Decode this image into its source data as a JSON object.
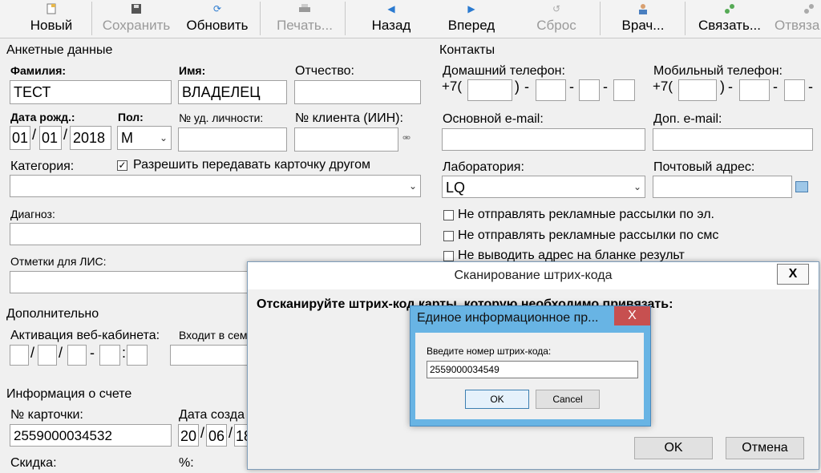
{
  "toolbar": {
    "new": "Новый",
    "save": "Сохранить",
    "refresh": "Обновить",
    "print": "Печать...",
    "back": "Назад",
    "forward": "Вперед",
    "reset": "Сброс",
    "doctor": "Врач...",
    "link": "Связать...",
    "unlink": "Отвяза"
  },
  "profile": {
    "group_title": "Анкетные данные",
    "last_name_label": "Фамилия:",
    "last_name_value": "ТЕСТ",
    "first_name_label": "Имя:",
    "first_name_value": "ВЛАДЕЛЕЦ",
    "patronymic_label": "Отчество:",
    "patronymic_value": "",
    "birth_label": "Дата рожд.:",
    "birth_day": "01",
    "birth_month": "01",
    "birth_year": "2018",
    "date_sep": "/",
    "sex_label": "Пол:",
    "sex_value": "М",
    "id_label": "№ уд. личности:",
    "iin_label": "№ клиента (ИИН):",
    "category_label": "Категория:",
    "share_checkbox": "Разрешить передавать карточку другом",
    "diagnosis_label": "Диагноз:",
    "lis_label": "Отметки для ЛИС:"
  },
  "contacts": {
    "group_title": "Контакты",
    "home_phone_label": "Домашний телефон:",
    "mobile_phone_label": "Мобильный телефон:",
    "phone_prefix": "+7(",
    "phone_close": ")",
    "phone_dash": "-",
    "email_label": "Основной e-mail:",
    "email2_label": "Доп. e-mail:",
    "lab_label": "Лаборатория:",
    "lab_value": "LQ",
    "postal_label": "Почтовый адрес:",
    "chk_email_ads": "Не отправлять рекламные рассылки по эл.",
    "chk_sms_ads": "Не отправлять рекламные рассылки по смс",
    "chk_address": "Не выводить адрес на бланке результ"
  },
  "extra": {
    "group_title": "Дополнительно",
    "web_label": "Активация веб-кабинета:",
    "family_label": "Входит в семе"
  },
  "account": {
    "group_title": "Информация о счете",
    "card_label": "№ карточки:",
    "card_value": "2559000034532",
    "created_label": "Дата созда",
    "created_day": "20",
    "created_month": "06",
    "created_year": "18",
    "discount_label": "Скидка:",
    "percent_label": "%:"
  },
  "scan_dialog": {
    "title": "Сканирование штрих-кода",
    "close": "X",
    "prompt": "Отсканируйте штрих-код карты, которую необходимо привязать:",
    "ok": "OK",
    "cancel": "Отмена"
  },
  "input_dialog": {
    "title": "Единое информационное пр...",
    "close": "X",
    "label": "Введите номер штрих-кода:",
    "value": "2559000034549",
    "ok": "OK",
    "cancel": "Cancel"
  }
}
